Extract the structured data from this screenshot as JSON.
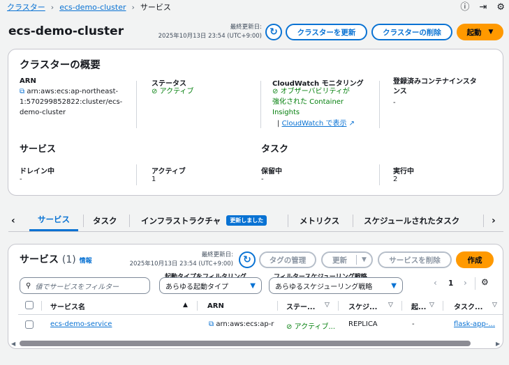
{
  "breadcrumb": {
    "items": [
      "クラスター",
      "ecs-demo-cluster",
      "サービス"
    ]
  },
  "header": {
    "title": "ecs-demo-cluster",
    "last_updated_label": "最終更新日:",
    "last_updated_value": "2025年10月13日 23:54 (UTC+9:00)",
    "update_cluster": "クラスターを更新",
    "delete_cluster": "クラスターの削除",
    "launch": "起動"
  },
  "overview": {
    "title": "クラスターの概要",
    "arn_label": "ARN",
    "arn_value": "arn:aws:ecs:ap-northeast-1:570299852822:cluster/ecs-demo-cluster",
    "arn_line1": "arn:aws:ecs:ap-northeast-",
    "arn_line2": "1:570299852822:cluster/ecs-",
    "arn_line3": "demo-cluster",
    "status_label": "ステータス",
    "status_value": "アクティブ",
    "cw_label": "CloudWatch モニタリング",
    "cw_line1": "オブザーバビリティが",
    "cw_line2": "強化された Container",
    "cw_line3": "Insights",
    "cw_link": "CloudWatch で表示",
    "instances_label_1": "登録済みコンテナインスタ",
    "instances_label_2": "ンス",
    "instances_value": "-",
    "services_heading": "サービス",
    "tasks_heading": "タスク",
    "draining_label": "ドレイン中",
    "draining_value": "-",
    "active_label": "アクティブ",
    "active_value": "1",
    "pending_label": "保留中",
    "pending_value": "-",
    "running_label": "実行中",
    "running_value": "2"
  },
  "tabs": [
    {
      "label": "サービス",
      "active": true
    },
    {
      "label": "タスク"
    },
    {
      "label": "インフラストラクチャ",
      "badge": "更新しました"
    },
    {
      "label": "メトリクス"
    },
    {
      "label": "スケジュールされたタスク"
    }
  ],
  "services_panel": {
    "title": "サービス",
    "count": "(1)",
    "info": "情報",
    "last_updated_label": "最終更新日:",
    "last_updated_value": "2025年10月13日 23:54 (UTC+9:00)",
    "manage_tags": "タグの管理",
    "update": "更新",
    "delete_service": "サービスを削除",
    "create": "作成",
    "search_placeholder": "値でサービスをフィルター",
    "launch_type_label": "起動タイプをフィルタリング",
    "launch_type_value": "あらゆる起動タイプ",
    "strategy_label": "フィルタースケジューリング戦略",
    "strategy_value": "あらゆるスケジューリング戦略",
    "page": "1",
    "columns": [
      "サービス名",
      "ARN",
      "ステー...",
      "スケジ...",
      "起...",
      "タスク..."
    ],
    "rows": [
      {
        "name": "ecs-demo-service",
        "arn": "arn:aws:ecs:ap-r",
        "status": "アクティブ...",
        "scheduling": "REPLICA",
        "launch": "-",
        "task": "flask-app-..."
      }
    ]
  },
  "colors": {
    "link": "#0972d3",
    "primary": "#ff9900",
    "success": "#037f0c",
    "badge": "#0972d3"
  }
}
